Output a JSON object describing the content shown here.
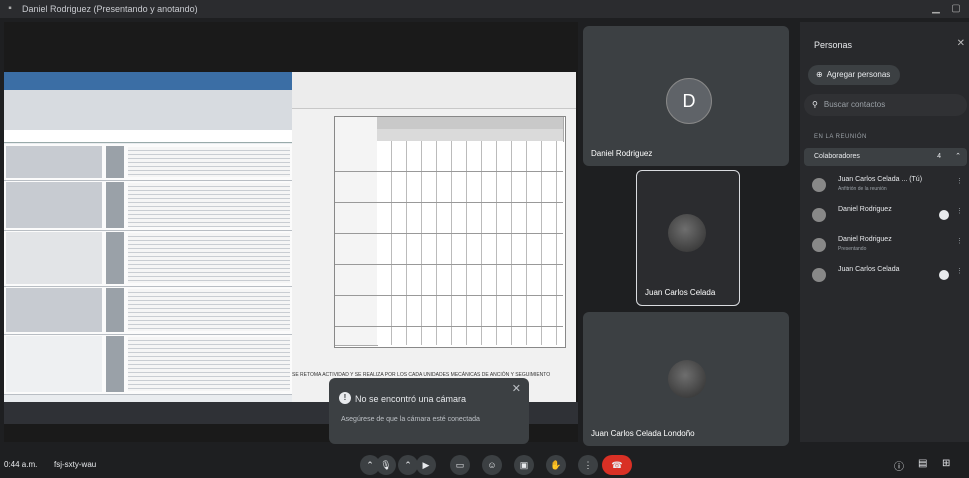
{
  "window": {
    "title": "Daniel Rodriguez (Presentando y anotando)"
  },
  "share": {
    "doc_note": "SE RETOMA ACTIVIDAD Y SE REALIZA POR LOS CADA UNIDADES MECÁNICAS DE ANCIÓN Y SEGUIMIENTO"
  },
  "toast": {
    "title": "No se encontró una cámara",
    "subtitle": "Asegúrese de que la cámara esté conectada",
    "close": "✕"
  },
  "tiles": {
    "daniel": {
      "name": "Daniel Rodriguez",
      "initial": "D"
    },
    "juan_carlos": {
      "name": "Juan Carlos Celada"
    },
    "juan_carlos_lon": {
      "name": "Juan Carlos Celada Londoño"
    }
  },
  "panel": {
    "title": "Personas",
    "add_label": "Agregar personas",
    "search_placeholder": "Buscar contactos",
    "section": "EN LA REUNIÓN",
    "group": {
      "label": "Colaboradores",
      "count": "4"
    },
    "people": [
      {
        "name": "Juan Carlos Celada ...  (Tú)",
        "sub": "Anfitrión de la reunión"
      },
      {
        "name": "Daniel Rodriguez",
        "sub": ""
      },
      {
        "name": "Daniel Rodriguez",
        "sub": "Presentando"
      },
      {
        "name": "Juan Carlos Celada",
        "sub": ""
      }
    ]
  },
  "bottom": {
    "time": "0:44 a.m.",
    "code": "fsj-sxty-wau"
  },
  "colors": {
    "bg": "#1e1f21",
    "tile": "#3c4043",
    "end_call": "#d93025",
    "accent": "#8ab4f8"
  }
}
